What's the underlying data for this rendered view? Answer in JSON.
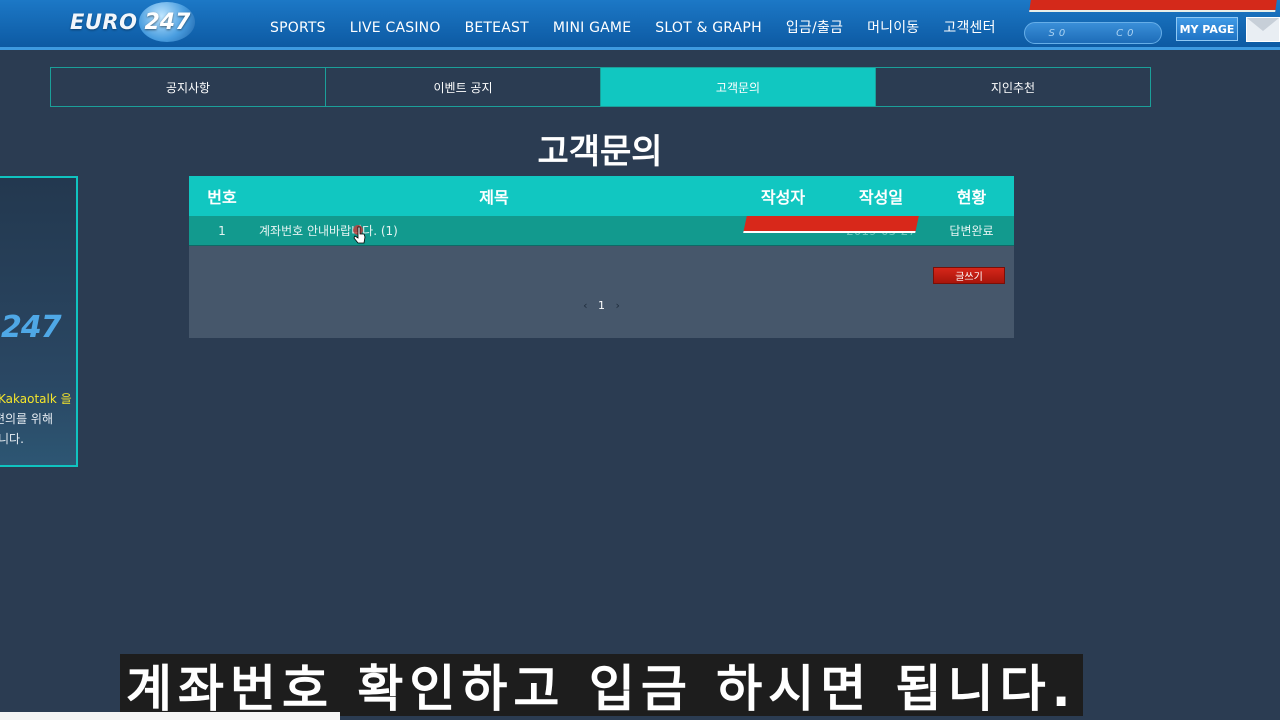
{
  "header": {
    "logo_text": "EURO",
    "logo_number": "247",
    "nav": [
      "SPORTS",
      "LIVE CASINO",
      "BETEAST",
      "MINI GAME",
      "SLOT & GRAPH",
      "입금/출금",
      "머니이동",
      "고객센터"
    ],
    "balance_left": "S0",
    "balance_right": "C0",
    "mypage_label": "MY PAGE"
  },
  "tabs": [
    {
      "label": "공지사항",
      "active": false
    },
    {
      "label": "이벤트 공지",
      "active": false
    },
    {
      "label": "고객문의",
      "active": true
    },
    {
      "label": "지인추천",
      "active": false
    }
  ],
  "page_title": "고객문의",
  "side_panel": {
    "brand": "247",
    "lines": [
      "Kakaotalk 을",
      "편의를 위해",
      "니다."
    ]
  },
  "board": {
    "columns": [
      "번호",
      "제목",
      "작성자",
      "작성일",
      "현황"
    ],
    "rows": [
      {
        "num": "1",
        "title": "계좌번호 안내바랍니다.",
        "comments": "(1)",
        "author": "",
        "date": "2019-05-27",
        "status": "답변완료"
      }
    ],
    "write_button": "글쓰기",
    "pager": {
      "prev": "‹",
      "current": "1",
      "next": "›"
    }
  },
  "subtitle": "계좌번호 확인하고 입금 하시면 됩니다."
}
